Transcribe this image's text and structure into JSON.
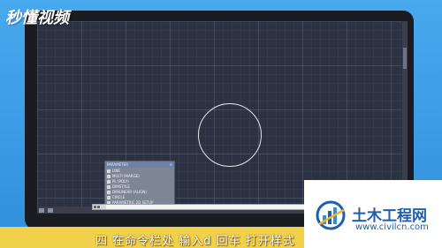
{
  "logo": {
    "text": "秒懂视频"
  },
  "palette": {
    "title": "PARAMETER",
    "items": [
      "LINE",
      "MULTI (MARGE)",
      "PL (POLY)",
      "DIMSTYLE",
      "DIMLINEAR (ALIGN)",
      "CIRCLE",
      "PARAMETRIC 2D SETUP"
    ]
  },
  "command_line": {
    "value": ""
  },
  "caption": {
    "text": "四 在命令栏处 输入d 回车 打开样式"
  },
  "watermark": {
    "title": "土木工程网",
    "url": "www.civilcn.com"
  },
  "colors": {
    "background": "#3d9ee8",
    "canvas": "#2c3241",
    "caption_bar": "#f2d14a",
    "watermark_blue": "#1c5fb0"
  }
}
